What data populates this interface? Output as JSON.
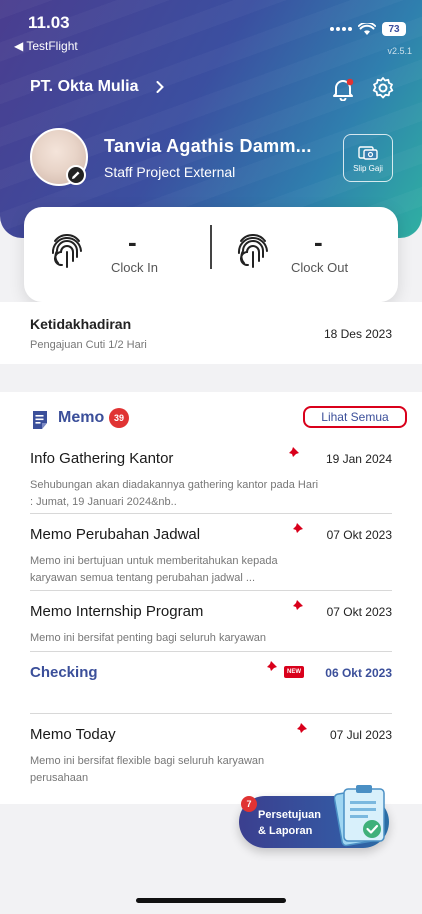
{
  "status_bar": {
    "time": "11.03",
    "back_app": "◀ TestFlight",
    "battery": "73",
    "version": "v2.5.1"
  },
  "header": {
    "company": "PT. Okta Mulia",
    "user_name": "Tanvia Agathis Damm...",
    "user_role": "Staff Project External",
    "slip_label": "Slip Gaji"
  },
  "clock": {
    "in_value": "-",
    "in_label": "Clock In",
    "out_value": "-",
    "out_label": "Clock Out"
  },
  "absence": {
    "title": "Ketidakhadiran",
    "subtitle": "Pengajuan Cuti 1/2 Hari",
    "date": "18 Des 2023"
  },
  "memo": {
    "title": "Memo",
    "count": "39",
    "see_all": "Lihat Semua",
    "items": [
      {
        "title": "Info Gathering Kantor",
        "desc": "Sehubungan akan diadakannya gathering kantor pada Hari : Jumat, 19 Januari 2024&nb..",
        "date": "19 Jan 2024"
      },
      {
        "title": "Memo Perubahan Jadwal",
        "desc": "Memo ini bertujuan untuk memberitahukan kepada karyawan semua tentang perubahan jadwal ...",
        "date": "07 Okt 2023"
      },
      {
        "title": "Memo Internship Program",
        "desc": "Memo ini bersifat penting bagi seluruh karyawan",
        "date": "07 Okt 2023"
      },
      {
        "title": "Checking",
        "desc": "",
        "date": "06 Okt 2023",
        "badge": "NEW"
      },
      {
        "title": "Memo Today",
        "desc": "Memo ini bersifat flexible bagi seluruh karyawan perusahaan",
        "date": "07 Jul 2023"
      }
    ]
  },
  "fab": {
    "count": "7",
    "line1": "Persetujuan",
    "line2": "& Laporan"
  },
  "colors": {
    "brand": "#3b4f9a",
    "alert": "#e03333",
    "pin": "#d9001b"
  }
}
